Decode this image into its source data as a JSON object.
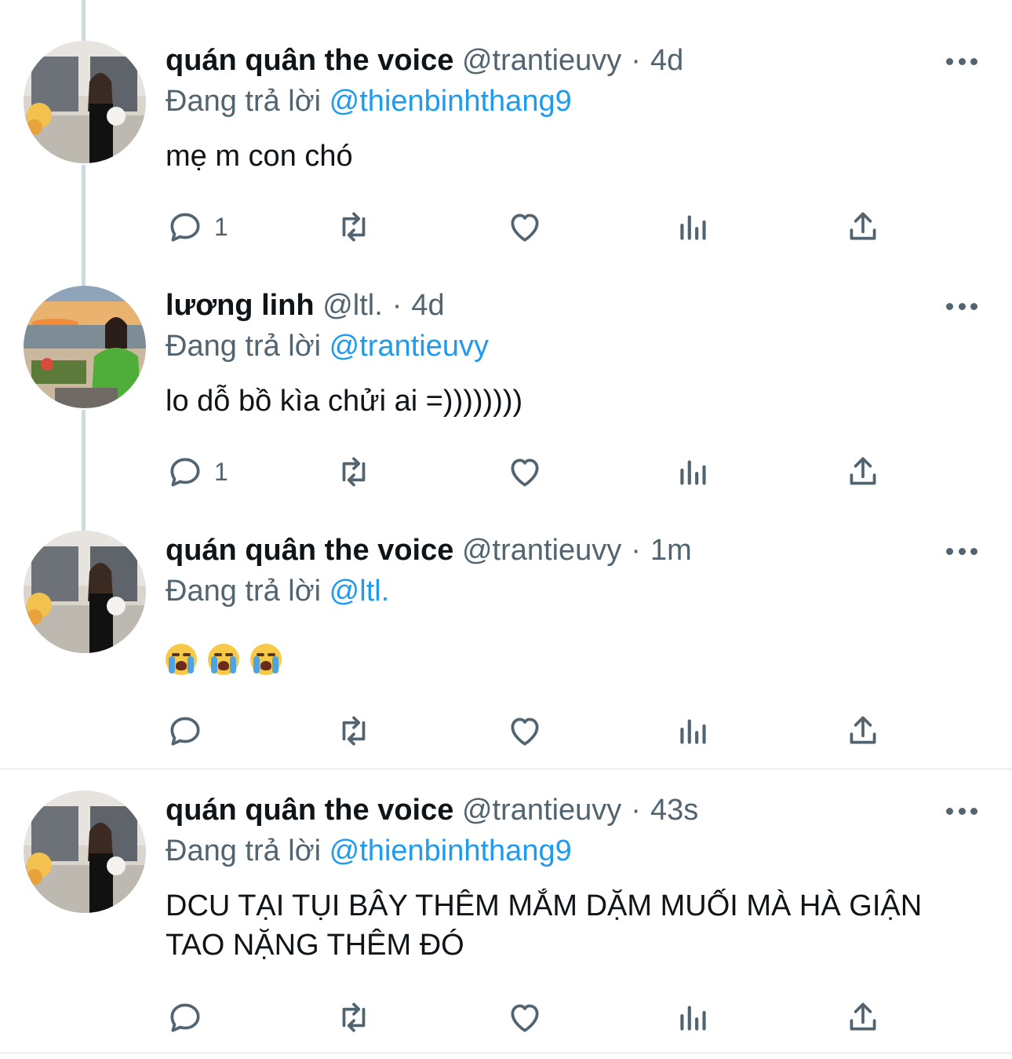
{
  "tweets": [
    {
      "name": "quán quân the voice",
      "handle": "@trantieuvy",
      "time": "4d",
      "replying_label": "Đang trả lời",
      "replying_to": "@thienbinhthang9",
      "text": "mẹ m con chó",
      "reply_count": "1",
      "avatar": "woman-holding-dog-avatar"
    },
    {
      "name": "lương linh",
      "handle": "@ltl.",
      "time": "4d",
      "replying_label": "Đang trả lời",
      "replying_to": "@trantieuvy",
      "text": "lo dỗ bồ kìa chửi ai =))))))))",
      "reply_count": "1",
      "avatar": "woman-green-jacket-sunset-avatar"
    },
    {
      "name": "quán quân the voice",
      "handle": "@trantieuvy",
      "time": "1m",
      "replying_label": "Đang trả lời",
      "replying_to": "@ltl.",
      "text": "",
      "emojis": [
        "loudly-crying-face",
        "loudly-crying-face",
        "loudly-crying-face"
      ],
      "reply_count": "",
      "avatar": "woman-holding-dog-avatar"
    },
    {
      "name": "quán quân the voice",
      "handle": "@trantieuvy",
      "time": "43s",
      "replying_label": "Đang trả lời",
      "replying_to": "@thienbinhthang9",
      "text": "DCU TẠI TỤI BÂY THÊM MẮM DẶM MUỐI MÀ HÀ GIẬN TAO NẶNG THÊM ĐÓ",
      "reply_count": "",
      "avatar": "woman-holding-dog-avatar"
    }
  ],
  "icons": {
    "reply": "reply-bubble-icon",
    "retweet": "retweet-icon",
    "like": "heart-icon",
    "stats": "view-stats-icon",
    "share": "share-icon",
    "more": "more-options-icon"
  },
  "colors": {
    "text": "#0f1419",
    "secondary": "#536471",
    "mention": "#1d9bf0",
    "thread_line": "#cfd9de",
    "divider": "#eff3f4"
  }
}
